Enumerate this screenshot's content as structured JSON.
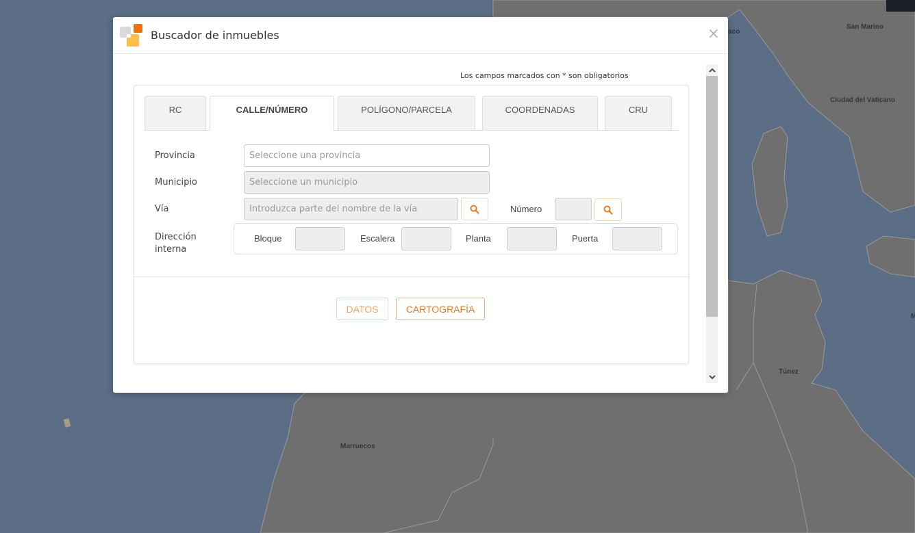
{
  "map": {
    "labels": [
      {
        "text": "San Marino"
      },
      {
        "text": "Ciudad del Vaticano"
      },
      {
        "text": "aco"
      },
      {
        "text": "Túnez"
      },
      {
        "text": "Marruecos"
      },
      {
        "text": "M"
      }
    ],
    "colors": {
      "sea": "#5b6e85",
      "land": "#6f6f6f",
      "border": "#9a9a9a"
    }
  },
  "modal": {
    "title": "Buscador de inmuebles",
    "close_icon": "×",
    "required_note": "Los campos marcados con * son obligatorios",
    "tabs": [
      {
        "label": "RC",
        "active": false
      },
      {
        "label": "CALLE/NÚMERO",
        "active": true
      },
      {
        "label": "POLÍGONO/PARCELA",
        "active": false
      },
      {
        "label": "COORDENADAS",
        "active": false
      },
      {
        "label": "CRU",
        "active": false
      }
    ],
    "form": {
      "provincia": {
        "label": "Provincia",
        "placeholder": "Seleccione una provincia",
        "value": ""
      },
      "municipio": {
        "label": "Municipio",
        "placeholder": "Seleccione un municipio",
        "value": ""
      },
      "via": {
        "label": "Vía",
        "placeholder": "Introduzca parte del nombre de la vía",
        "value": ""
      },
      "numero": {
        "label": "Número",
        "value": ""
      },
      "direccion_interna": {
        "label_line1": "Dirección",
        "label_line2": "interna",
        "fields": [
          {
            "label": "Bloque",
            "value": ""
          },
          {
            "label": "Escalera",
            "value": ""
          },
          {
            "label": "Planta",
            "value": ""
          },
          {
            "label": "Puerta",
            "value": ""
          }
        ]
      }
    },
    "buttons": {
      "datos": "DATOS",
      "cartografia": "CARTOGRAFÍA"
    },
    "accent_color": "#e07b2c",
    "scroll_up_icon": "⌃",
    "scroll_down_icon": "⌄"
  }
}
